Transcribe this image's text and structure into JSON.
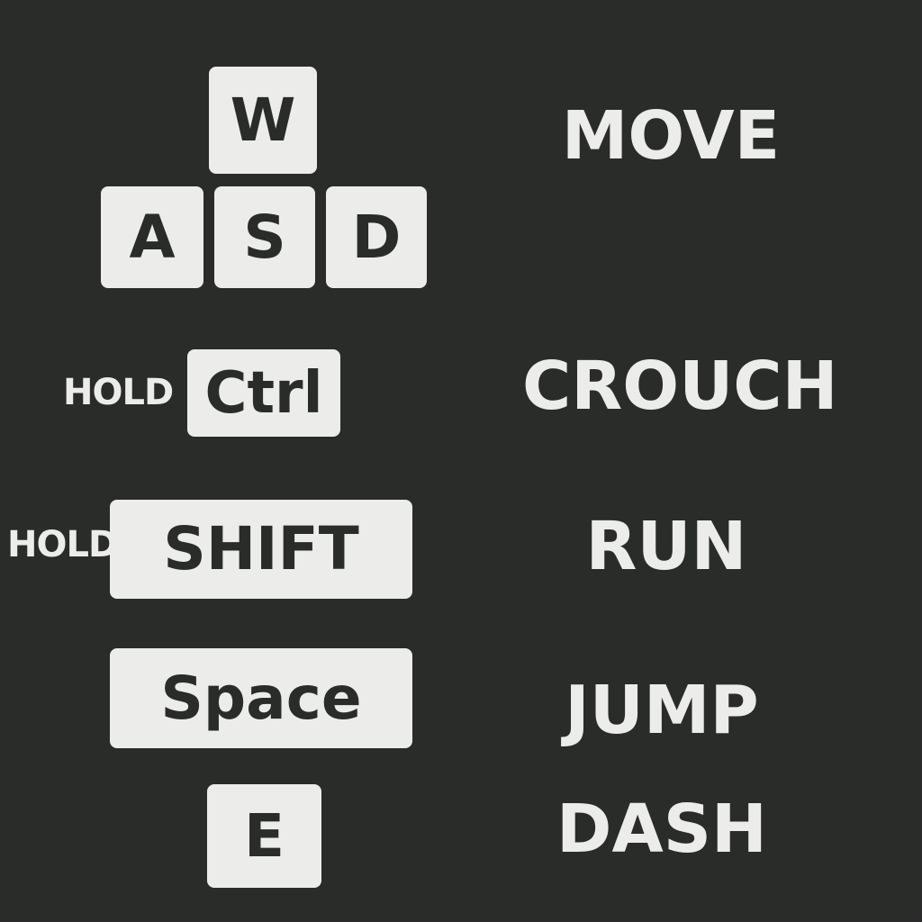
{
  "controls": [
    {
      "keys": [
        "W",
        "A",
        "S",
        "D"
      ],
      "modifier": "",
      "action": "MOVE"
    },
    {
      "keys": [
        "Ctrl"
      ],
      "modifier": "HOLD",
      "action": "CROUCH"
    },
    {
      "keys": [
        "SHIFT"
      ],
      "modifier": "HOLD",
      "action": "RUN"
    },
    {
      "keys": [
        "Space"
      ],
      "modifier": "",
      "action": "JUMP"
    },
    {
      "keys": [
        "E"
      ],
      "modifier": "",
      "action": "DASH"
    }
  ],
  "colors": {
    "background": "#2a2c29",
    "key_face": "#ececea",
    "key_text": "#2a2c29",
    "label_text": "#ececea"
  }
}
